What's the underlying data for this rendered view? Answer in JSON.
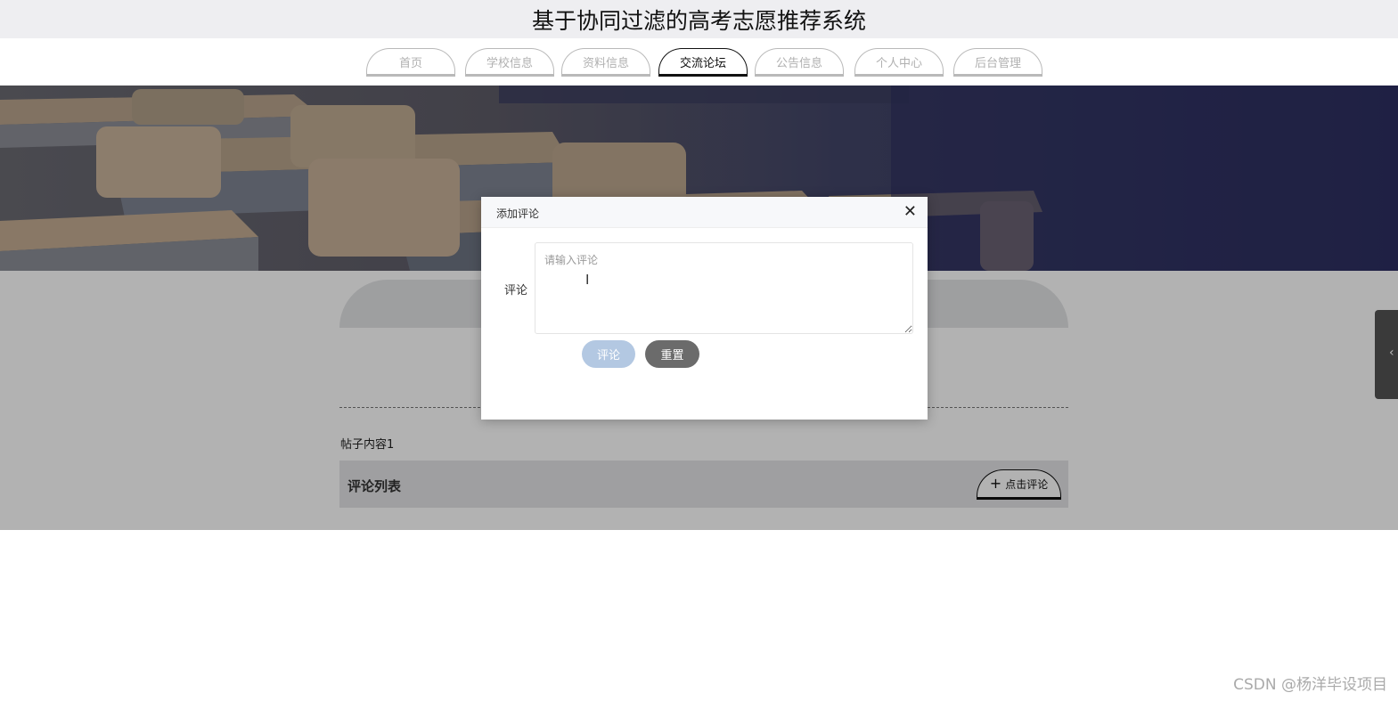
{
  "site": {
    "title": "基于协同过滤的高考志愿推荐系统"
  },
  "nav": {
    "items": [
      {
        "label": "首页",
        "active": false
      },
      {
        "label": "学校信息",
        "active": false
      },
      {
        "label": "资料信息",
        "active": false
      },
      {
        "label": "交流论坛",
        "active": true
      },
      {
        "label": "公告信息",
        "active": false
      },
      {
        "label": "个人中心",
        "active": false
      },
      {
        "label": "后台管理",
        "active": false
      }
    ]
  },
  "post": {
    "content": "帖子内容1",
    "comments_title": "评论列表",
    "add_comment_label": "点击评论"
  },
  "dialog": {
    "title": "添加评论",
    "field_label": "评论",
    "placeholder": "请输入评论",
    "submit_label": "评论",
    "reset_label": "重置"
  },
  "watermark": "CSDN @杨洋毕设项目",
  "colors": {
    "submit_button": "#b3c8e2",
    "reset_button": "#6b6b6b",
    "active_nav_border": "#111111"
  }
}
